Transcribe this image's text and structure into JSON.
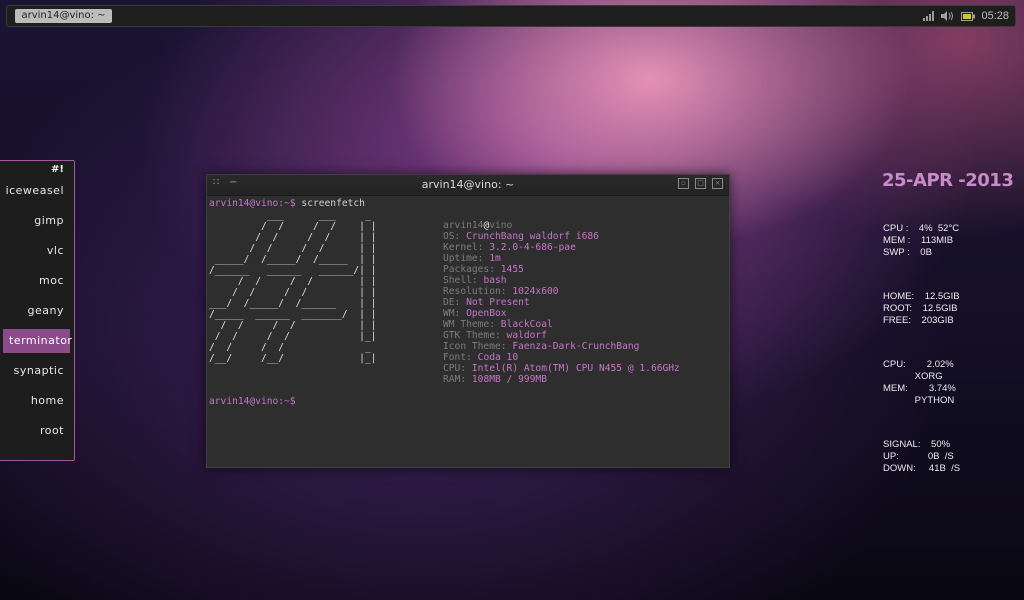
{
  "panel": {
    "task_label": "arvin14@vino: ~",
    "clock": "05:28"
  },
  "menu": {
    "title": "#!",
    "items": [
      "iceweasel",
      "gimp",
      "vlc",
      "moc",
      "geany",
      "terminator",
      "synaptic",
      "home",
      "root"
    ],
    "active_index": 5
  },
  "terminal": {
    "title": "arvin14@vino: ~",
    "prompt_user": "arvin14@vino:~$",
    "command": " screenfetch",
    "prompt_end": "arvin14@vino:~$",
    "ascii_art": "          ___      ___     _\n         /  /     /  /    | |\n        /  /     /  /     | |\n       /  /     /  /      | |\n _____/  /_____/  /_____  | |\n/______   ______   ______/| |\n     /  /     /  /        | |\n    /  /     /  /         | |\n___/  /_____/  /______    | |\n/_____  ______  _______/  | |\n  /  /     /  /           | |\n /  /     /  /            |_|\n/  /     /  /              _\n/__/     /__/             |_|",
    "info": [
      {
        "k": "arvin14",
        "v": "@",
        "tail": "vino"
      },
      {
        "k": "OS:",
        "v": "CrunchBang waldorf i686"
      },
      {
        "k": "Kernel:",
        "v": "3.2.0-4-686-pae"
      },
      {
        "k": "Uptime:",
        "v": "1m"
      },
      {
        "k": "Packages:",
        "v": "1455"
      },
      {
        "k": "Shell:",
        "v": "bash"
      },
      {
        "k": "Resolution:",
        "v": "1024x600"
      },
      {
        "k": "DE:",
        "v": "Not Present"
      },
      {
        "k": "WM:",
        "v": "OpenBox"
      },
      {
        "k": "WM Theme:",
        "v": "BlackCoal"
      },
      {
        "k": "GTK Theme:",
        "v": "waldorf"
      },
      {
        "k": "Icon Theme:",
        "v": "Faenza-Dark-CrunchBang"
      },
      {
        "k": "Font:",
        "v": "Coda 10"
      },
      {
        "k": "CPU:",
        "v": "Intel(R) Atom(TM) CPU N455 @ 1.66GHz"
      },
      {
        "k": "RAM:",
        "v": "108MB / 999MB"
      }
    ]
  },
  "conky": {
    "date": "25-APR -2013",
    "sys": [
      "CPU :    4%  52°C",
      "MEM :    113MIB",
      "SWP :    0B"
    ],
    "disk": [
      "HOME:    12.5GIB",
      "ROOT:    12.5GIB",
      "FREE:    203GIB"
    ],
    "top": [
      "CPU:        2.02%",
      "            XORG",
      "MEM:        3.74%",
      "            PYTHON"
    ],
    "net": [
      "SIGNAL:    50%",
      "UP:           0B  /S",
      "DOWN:     41B  /S"
    ]
  },
  "colors": {
    "accent": "#8b4b8b",
    "magenta_text": "#c875c8"
  }
}
